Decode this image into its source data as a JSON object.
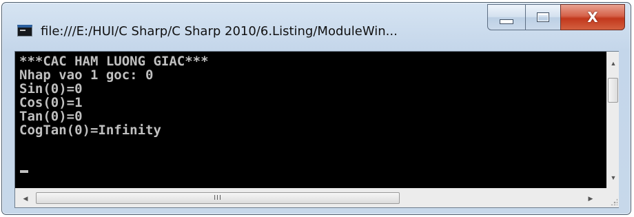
{
  "window": {
    "title": "file:///E:/HUI/C Sharp/C Sharp 2010/6.Listing/ModuleWin...",
    "icon": "console-app-icon"
  },
  "caption_buttons": {
    "minimize_icon": "minimize-icon",
    "maximize_icon": "maximize-icon",
    "close_symbol": "X"
  },
  "console": {
    "lines": [
      "***CAC HAM LUONG GIAC***",
      "Nhap vao 1 goc: 0",
      "Sin(0)=0",
      "Cos(0)=1",
      "Tan(0)=0",
      "CogTan(0)=Infinity"
    ],
    "colors": {
      "background": "#000000",
      "text": "#c0c0c0"
    }
  },
  "scrollbars": {
    "up_arrow": "▲",
    "down_arrow": "▼",
    "left_arrow": "◀",
    "right_arrow": "▶",
    "h_thumb_grip": "III"
  }
}
